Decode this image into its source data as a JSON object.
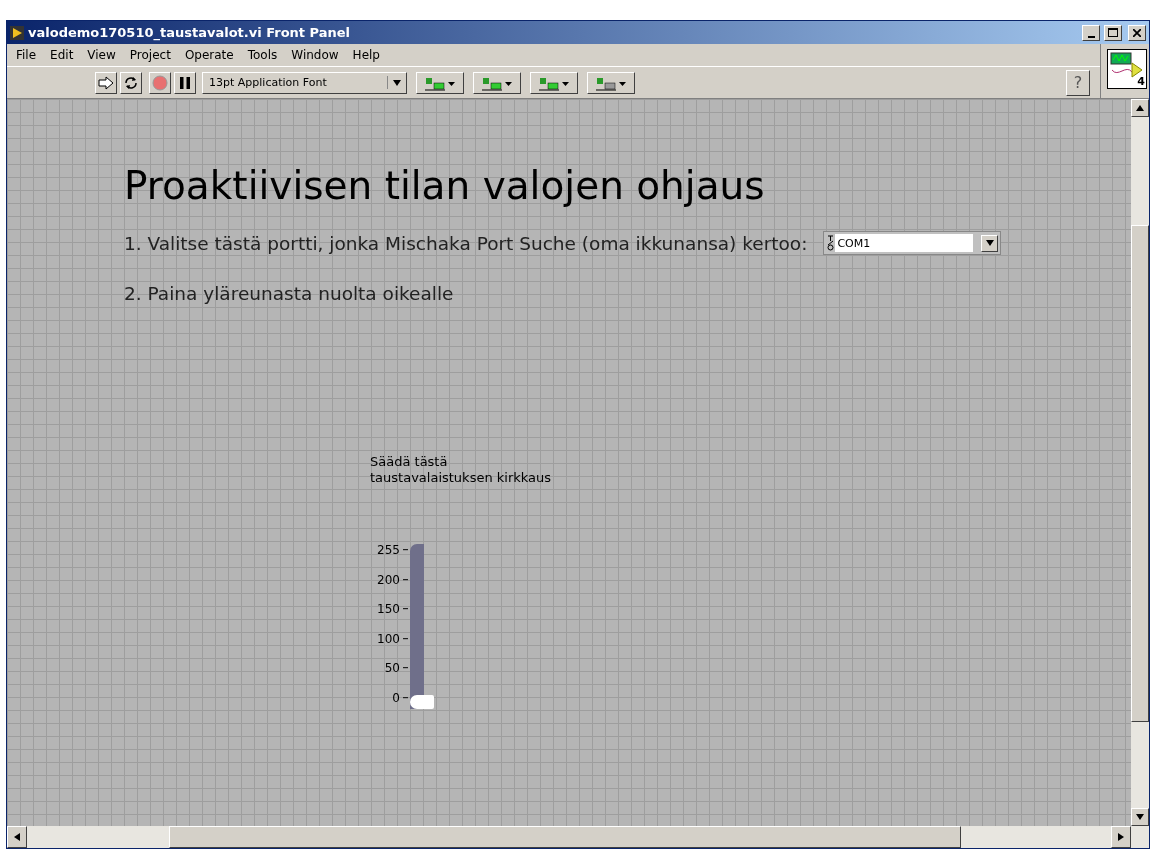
{
  "window": {
    "title": "valodemo170510_taustavalot.vi Front Panel"
  },
  "menu": [
    "File",
    "Edit",
    "View",
    "Project",
    "Operate",
    "Tools",
    "Window",
    "Help"
  ],
  "toolbar": {
    "font": "13pt Application Font",
    "help": "?",
    "connector_label": "4"
  },
  "panel": {
    "heading": "Proaktiivisen tilan valojen ohjaus",
    "step_1": "1. Valitse tästä portti, jonka Mischaka Port Suche (oma ikkunansa) kertoo:",
    "port": {
      "value": "COM1"
    },
    "step_2": "2. Paina yläreunasta nuolta oikealle",
    "slider": {
      "label": "Säädä tästä\ntaustavalaistuksen kirkkaus",
      "ticks": [
        "255",
        "200",
        "150",
        "100",
        "50",
        "0"
      ],
      "level": 0
    }
  }
}
